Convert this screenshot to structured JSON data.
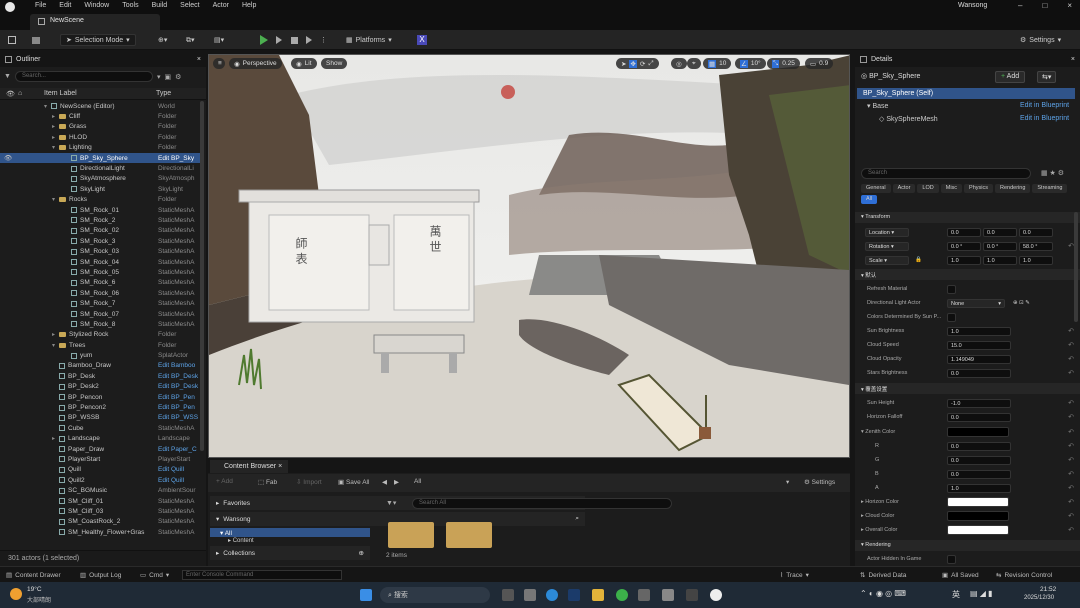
{
  "menubar": {
    "items": [
      "File",
      "Edit",
      "Window",
      "Tools",
      "Build",
      "Select",
      "Actor",
      "Help"
    ],
    "user": "Wansong"
  },
  "tab": {
    "label": "NewScene"
  },
  "toolbar": {
    "mode": "Selection Mode",
    "platforms": "Platforms",
    "settings": "Settings"
  },
  "outliner": {
    "title": "Outliner",
    "search_placeholder": "Search...",
    "col_label": "Item Label",
    "col_type": "Type",
    "rows": [
      {
        "name": "NewScene (Editor)",
        "type": "World",
        "depth": 0,
        "kind": "world",
        "arrow": "▾"
      },
      {
        "name": "Cliff",
        "type": "Folder",
        "depth": 1,
        "kind": "folder",
        "arrow": "▸"
      },
      {
        "name": "Grass",
        "type": "Folder",
        "depth": 1,
        "kind": "folder",
        "arrow": "▸"
      },
      {
        "name": "HLOD",
        "type": "Folder",
        "depth": 1,
        "kind": "folder",
        "arrow": "▸"
      },
      {
        "name": "Lighting",
        "type": "Folder",
        "depth": 1,
        "kind": "folder",
        "arrow": "▾"
      },
      {
        "name": "BP_Sky_Sphere",
        "type": "Edit BP_Sky",
        "depth": 2,
        "kind": "actor",
        "arrow": "",
        "sel": true,
        "link": true
      },
      {
        "name": "DirectionalLight",
        "type": "DirectionalLi",
        "depth": 2,
        "kind": "actor",
        "arrow": ""
      },
      {
        "name": "SkyAtmosphere",
        "type": "SkyAtmosph",
        "depth": 2,
        "kind": "actor",
        "arrow": ""
      },
      {
        "name": "SkyLight",
        "type": "SkyLight",
        "depth": 2,
        "kind": "actor",
        "arrow": ""
      },
      {
        "name": "Rocks",
        "type": "Folder",
        "depth": 1,
        "kind": "folder",
        "arrow": "▾"
      },
      {
        "name": "SM_Rock_01",
        "type": "StaticMeshA",
        "depth": 2,
        "kind": "actor",
        "arrow": ""
      },
      {
        "name": "SM_Rock_2",
        "type": "StaticMeshA",
        "depth": 2,
        "kind": "actor",
        "arrow": ""
      },
      {
        "name": "SM_Rock_02",
        "type": "StaticMeshA",
        "depth": 2,
        "kind": "actor",
        "arrow": ""
      },
      {
        "name": "SM_Rock_3",
        "type": "StaticMeshA",
        "depth": 2,
        "kind": "actor",
        "arrow": ""
      },
      {
        "name": "SM_Rock_03",
        "type": "StaticMeshA",
        "depth": 2,
        "kind": "actor",
        "arrow": ""
      },
      {
        "name": "SM_Rock_04",
        "type": "StaticMeshA",
        "depth": 2,
        "kind": "actor",
        "arrow": ""
      },
      {
        "name": "SM_Rock_05",
        "type": "StaticMeshA",
        "depth": 2,
        "kind": "actor",
        "arrow": ""
      },
      {
        "name": "SM_Rock_6",
        "type": "StaticMeshA",
        "depth": 2,
        "kind": "actor",
        "arrow": ""
      },
      {
        "name": "SM_Rock_06",
        "type": "StaticMeshA",
        "depth": 2,
        "kind": "actor",
        "arrow": ""
      },
      {
        "name": "SM_Rock_7",
        "type": "StaticMeshA",
        "depth": 2,
        "kind": "actor",
        "arrow": ""
      },
      {
        "name": "SM_Rock_07",
        "type": "StaticMeshA",
        "depth": 2,
        "kind": "actor",
        "arrow": ""
      },
      {
        "name": "SM_Rock_8",
        "type": "StaticMeshA",
        "depth": 2,
        "kind": "actor",
        "arrow": ""
      },
      {
        "name": "Stylized Rock",
        "type": "Folder",
        "depth": 1,
        "kind": "folder",
        "arrow": "▸"
      },
      {
        "name": "Trees",
        "type": "Folder",
        "depth": 1,
        "kind": "folder",
        "arrow": "▾"
      },
      {
        "name": "yum",
        "type": "SplatActor",
        "depth": 2,
        "kind": "actor",
        "arrow": ""
      },
      {
        "name": "Bamboo_Draw",
        "type": "Edit Bamboo",
        "depth": 1,
        "kind": "actor",
        "arrow": "",
        "link": true
      },
      {
        "name": "BP_Desk",
        "type": "Edit BP_Desk",
        "depth": 1,
        "kind": "actor",
        "arrow": "",
        "link": true
      },
      {
        "name": "BP_Desk2",
        "type": "Edit BP_Desk",
        "depth": 1,
        "kind": "actor",
        "arrow": "",
        "link": true
      },
      {
        "name": "BP_Pencon",
        "type": "Edit BP_Pen",
        "depth": 1,
        "kind": "actor",
        "arrow": "",
        "link": true
      },
      {
        "name": "BP_Pencon2",
        "type": "Edit BP_Pen",
        "depth": 1,
        "kind": "actor",
        "arrow": "",
        "link": true
      },
      {
        "name": "BP_WSSB",
        "type": "Edit BP_WSS",
        "depth": 1,
        "kind": "actor",
        "arrow": "",
        "link": true
      },
      {
        "name": "Cube",
        "type": "StaticMeshA",
        "depth": 1,
        "kind": "actor",
        "arrow": ""
      },
      {
        "name": "Landscape",
        "type": "Landscape",
        "depth": 1,
        "kind": "actor",
        "arrow": "▸"
      },
      {
        "name": "Paper_Draw",
        "type": "Edit Paper_C",
        "depth": 1,
        "kind": "actor",
        "arrow": "",
        "link": true
      },
      {
        "name": "PlayerStart",
        "type": "PlayerStart",
        "depth": 1,
        "kind": "actor",
        "arrow": ""
      },
      {
        "name": "Quill",
        "type": "Edit Quill",
        "depth": 1,
        "kind": "actor",
        "arrow": "",
        "link": true
      },
      {
        "name": "Quill2",
        "type": "Edit Quill",
        "depth": 1,
        "kind": "actor",
        "arrow": "",
        "link": true
      },
      {
        "name": "SC_BGMusic",
        "type": "AmbientSour",
        "depth": 1,
        "kind": "actor",
        "arrow": ""
      },
      {
        "name": "SM_Cliff_01",
        "type": "StaticMeshA",
        "depth": 1,
        "kind": "actor",
        "arrow": ""
      },
      {
        "name": "SM_Cliff_03",
        "type": "StaticMeshA",
        "depth": 1,
        "kind": "actor",
        "arrow": ""
      },
      {
        "name": "SM_CoastRock_2",
        "type": "StaticMeshA",
        "depth": 1,
        "kind": "actor",
        "arrow": ""
      },
      {
        "name": "SM_Healthy_Flower+Gras",
        "type": "StaticMeshA",
        "depth": 1,
        "kind": "actor",
        "arrow": ""
      }
    ],
    "footer": "301 actors (1 selected)"
  },
  "viewport": {
    "perspective": "Perspective",
    "lit": "Lit",
    "show": "Show",
    "grid": "10",
    "angle": "10°",
    "scale": "0.25",
    "cam": "0.9",
    "stele_left": "師 表",
    "stele_right": "萬 世"
  },
  "content": {
    "tab": "Content Browser",
    "add": "Add",
    "fab": "Fab",
    "import": "Import",
    "save_all": "Save All",
    "path": "All",
    "settings": "Settings",
    "favorites": "Favorites",
    "project": "Wansong",
    "tree_all": "All",
    "tree_content": "Content",
    "collections": "Collections",
    "search_placeholder": "Search All",
    "items_count": "2 items"
  },
  "details": {
    "tab": "Details",
    "actor": "BP_Sky_Sphere",
    "add": "Add",
    "self": "BP_Sky_Sphere (Self)",
    "base": "Base",
    "mesh": "SkySphereMesh",
    "edit_bp": "Edit in Blueprint",
    "search_placeholder": "Search",
    "filters": [
      "General",
      "Actor",
      "LOD",
      "Misc",
      "Physics",
      "Rendering",
      "Streaming",
      "All"
    ],
    "transform": "Transform",
    "location": {
      "label": "Location",
      "x": "0.0",
      "y": "0.0",
      "z": "0.0"
    },
    "rotation": {
      "label": "Rotation",
      "x": "0.0 °",
      "y": "0.0 °",
      "z": "58.0 °"
    },
    "scale": {
      "label": "Scale",
      "x": "1.0",
      "y": "1.0",
      "z": "1.0"
    },
    "default_cat": "默认",
    "refresh": "Refresh Material",
    "dir_light": {
      "label": "Directional Light Actor",
      "value": "None"
    },
    "colors_by_sun": "Colors Determined By Sun P...",
    "sun_brightness": {
      "label": "Sun Brightness",
      "value": "1.0"
    },
    "cloud_speed": {
      "label": "Cloud Speed",
      "value": "15.0"
    },
    "cloud_opacity": {
      "label": "Cloud Opacity",
      "value": "1.149049"
    },
    "stars": {
      "label": "Stars Brightness",
      "value": "0.0"
    },
    "override_cat": "覆盖设置",
    "sun_height": {
      "label": "Sun Height",
      "value": "-1.0"
    },
    "horizon_falloff": {
      "label": "Horizon Falloff",
      "value": "0.0"
    },
    "zenith": {
      "label": "Zenith Color",
      "r": "0.0",
      "g": "0.0",
      "b": "0.0",
      "a": "1.0"
    },
    "horizon_color": "Horizon Color",
    "cloud_color": "Cloud Color",
    "overall_color": "Overall Color",
    "rendering": "Rendering",
    "hidden": "Actor Hidden In Game"
  },
  "statusbar": {
    "drawer": "Content Drawer",
    "output": "Output Log",
    "cmd": "Cmd",
    "console_placeholder": "Enter Console Command",
    "trace": "Trace",
    "derived": "Derived Data",
    "saved": "All Saved",
    "revision": "Revision Control"
  },
  "taskbar": {
    "temp": "19°C",
    "weather": "大部晴朗",
    "search": "搜索",
    "lang": "英",
    "time": "21:52",
    "date": "2025/12/30"
  },
  "colors": {
    "accent": "#2f6fd6",
    "selection": "#30548a",
    "link": "#5da3e8"
  }
}
